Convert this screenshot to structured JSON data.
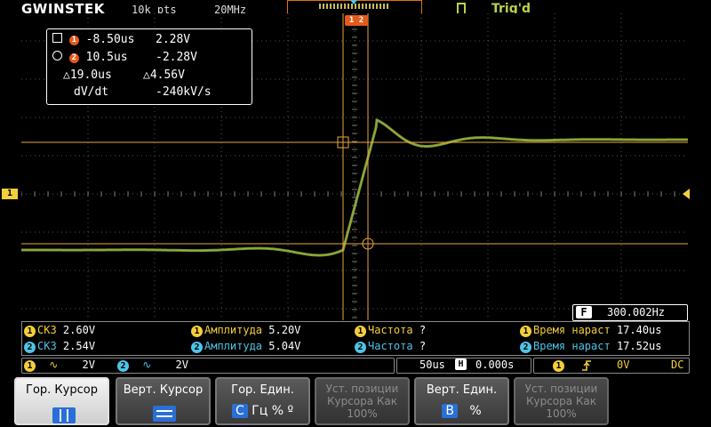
{
  "header": {
    "brand": "GWINSTEK",
    "record_length": "10k pts",
    "bandwidth": "20MHz",
    "trigger_status": "Trig'd"
  },
  "cursor_readout": {
    "cursor1_time": "-8.50us",
    "cursor1_volt": "2.28V",
    "cursor2_time": "10.5us",
    "cursor2_volt": "-2.28V",
    "delta_time": "19.0us",
    "delta_volt": "4.56V",
    "dvdt_label": "dV/dt",
    "dvdt_value": "-240kV/s",
    "marker_label": "1 2"
  },
  "frequency_counter": {
    "label": "F",
    "value": "300.002Hz"
  },
  "measurements": [
    {
      "ch": "1",
      "name": "СКЗ",
      "value": "2.60V"
    },
    {
      "ch": "2",
      "name": "СКЗ",
      "value": "2.54V"
    },
    {
      "ch": "1",
      "name": "Амплитуда",
      "value": "5.20V"
    },
    {
      "ch": "2",
      "name": "Амплитуда",
      "value": "5.04V"
    },
    {
      "ch": "1",
      "name": "Частота",
      "value": "?"
    },
    {
      "ch": "2",
      "name": "Частота",
      "value": "?"
    },
    {
      "ch": "1",
      "name": "Время нараст",
      "value": "17.40us"
    },
    {
      "ch": "2",
      "name": "Время нараст",
      "value": "17.52us"
    }
  ],
  "status": {
    "ch1_num": "1",
    "ch1_scale": "2V",
    "ch2_num": "2",
    "ch2_scale": "2V",
    "timebase": "50us",
    "h_label": "H",
    "h_position": "0.000s",
    "trig_ch": "1",
    "trig_level": "0V",
    "coupling": "DC"
  },
  "softkeys": [
    {
      "label": "Гор. Курсор"
    },
    {
      "label": "Верт. Курсор"
    },
    {
      "label": "Гор. Един.",
      "opt_sel": "С",
      "opt_rest": "Гц  %  º"
    },
    {
      "label": "Уст. позиции Курсора Как 100%"
    },
    {
      "label": "Верт. Един.",
      "opt_sel": "В",
      "opt_rest": "%"
    },
    {
      "label": "Уст. позиции Курсора Как 100%"
    }
  ],
  "colors": {
    "ch1": "#f4cf3c",
    "ch2": "#4fc4e6",
    "trace": "#6e9a3a",
    "cursor": "#e8a93c",
    "accent": "#2a6fd6"
  }
}
